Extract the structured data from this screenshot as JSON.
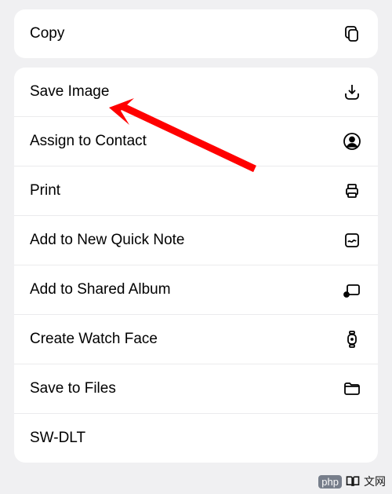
{
  "group1": {
    "copy": {
      "label": "Copy"
    }
  },
  "group2": {
    "save_image": {
      "label": "Save Image"
    },
    "assign_contact": {
      "label": "Assign to Contact"
    },
    "print": {
      "label": "Print"
    },
    "add_quick_note": {
      "label": "Add to New Quick Note"
    },
    "add_shared_album": {
      "label": "Add to Shared Album"
    },
    "create_watch_face": {
      "label": "Create Watch Face"
    },
    "save_to_files": {
      "label": "Save to Files"
    },
    "sw_dlt": {
      "label": "SW-DLT"
    }
  },
  "watermark": {
    "php": "php",
    "text": "文网"
  }
}
